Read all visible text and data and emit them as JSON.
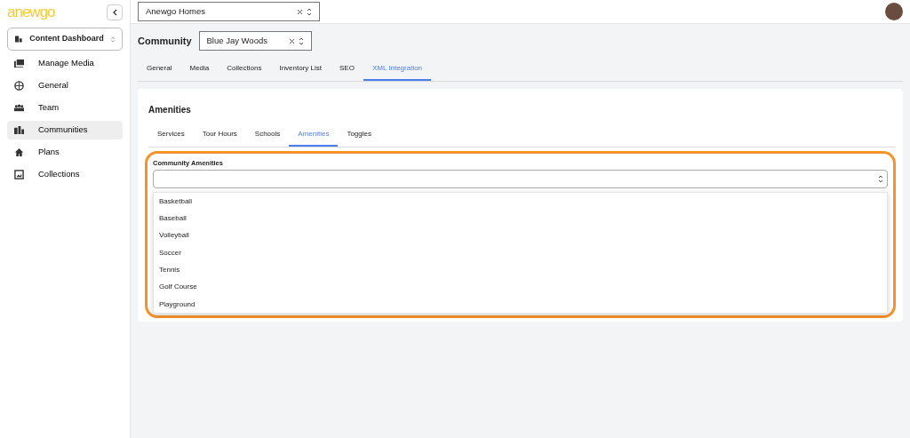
{
  "brand": {
    "logo": "anewgo"
  },
  "sidebar": {
    "dashboard_select": "Content Dashboard",
    "items": [
      {
        "label": "Manage Media",
        "selected": false
      },
      {
        "label": "General",
        "selected": false
      },
      {
        "label": "Team",
        "selected": false
      },
      {
        "label": "Communities",
        "selected": true
      },
      {
        "label": "Plans",
        "selected": false
      },
      {
        "label": "Collections",
        "selected": false
      }
    ]
  },
  "top_select": {
    "value": "Anewgo Homes"
  },
  "community": {
    "label": "Community",
    "value": "Blue Jay Woods"
  },
  "tabs": [
    {
      "label": "General",
      "selected": false
    },
    {
      "label": "Media",
      "selected": false
    },
    {
      "label": "Collections",
      "selected": false
    },
    {
      "label": "Inventory List",
      "selected": false
    },
    {
      "label": "SEO",
      "selected": false
    },
    {
      "label": "XML Integration",
      "selected": true
    }
  ],
  "card": {
    "title": "Amenities",
    "subtabs": [
      {
        "label": "Services",
        "selected": false
      },
      {
        "label": "Tour Hours",
        "selected": false
      },
      {
        "label": "Schools",
        "selected": false
      },
      {
        "label": "Amenities",
        "selected": true
      },
      {
        "label": "Toggles",
        "selected": false
      }
    ],
    "field_label": "Community Amenities",
    "options": [
      "Basketball",
      "Baseball",
      "Volleyball",
      "Soccer",
      "Tennis",
      "Golf Course",
      "Playground"
    ]
  }
}
